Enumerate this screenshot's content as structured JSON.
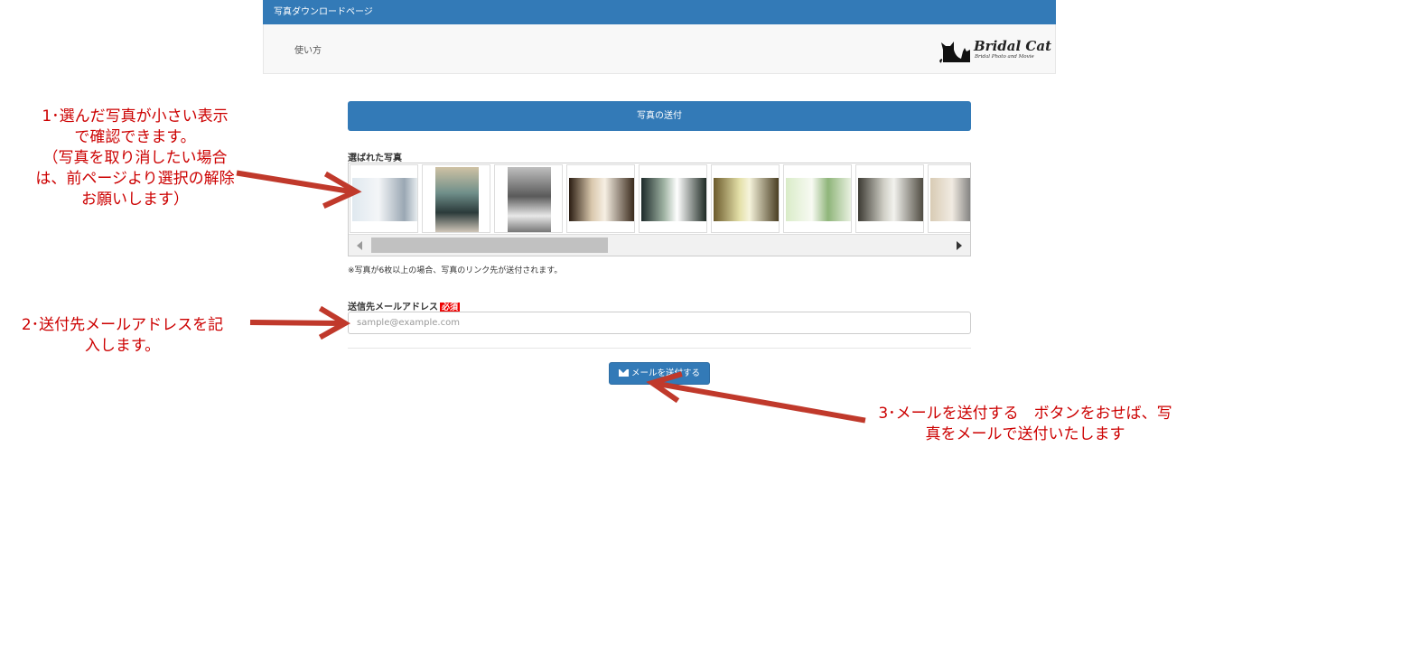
{
  "header": {
    "title": "写真ダウンロードページ"
  },
  "nav": {
    "link": "使い方"
  },
  "logo": {
    "name": "Bridal Cat",
    "sub": "Bridal Photo and Movie"
  },
  "panel": {
    "heading": "写真の送付"
  },
  "gallery": {
    "label": "選ばれた写真",
    "photos": [
      {
        "name": "photo-1"
      },
      {
        "name": "photo-2"
      },
      {
        "name": "photo-3"
      },
      {
        "name": "photo-4"
      },
      {
        "name": "photo-5"
      },
      {
        "name": "photo-6"
      },
      {
        "name": "photo-7"
      },
      {
        "name": "photo-8"
      },
      {
        "name": "photo-9"
      }
    ]
  },
  "note": "※写真が6枚以上の場合、写真のリンク先が送付されます。",
  "email": {
    "label": "送信先メールアドレス",
    "required": "必須",
    "placeholder": "sample@example.com"
  },
  "send_button": {
    "label": "メールを送付する",
    "icon": "envelope-icon"
  },
  "annotations": {
    "a1": "1･選んだ写真が小さい表示\nで確認できます。\n（写真を取り消したい場合\nは、前ページより選択の解除\nお願いします）",
    "a2": "2･送付先メールアドレスを記\n入します。",
    "a3": "3･メールを送付する　ボタンをおせば、写\n真をメールで送付いたします"
  },
  "colors": {
    "primary": "#337ab7",
    "annotation": "#cc0000",
    "arrow": "#c0392b",
    "required": "#ee0000"
  }
}
